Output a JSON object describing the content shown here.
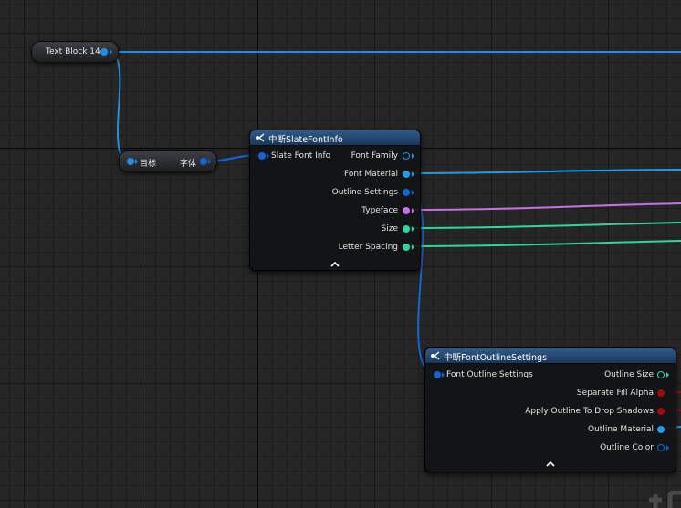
{
  "colors": {
    "object": "#1c8fe8",
    "struct": "#1366d8",
    "material": "#1c9ee6",
    "typeface": "#c773e6",
    "number": "#2ed6a1",
    "bool": "#a10b0b",
    "header": "#2a5384"
  },
  "text_block_node": {
    "label": "Text Block 14"
  },
  "font_getter_node": {
    "target_label": "目标",
    "output_label": "字体"
  },
  "break_slate_font_info": {
    "title": "中断SlateFontInfo",
    "input": "Slate Font Info",
    "outputs": [
      {
        "label": "Font Family",
        "type": "object-hollow"
      },
      {
        "label": "Font Material",
        "type": "material"
      },
      {
        "label": "Outline Settings",
        "type": "struct"
      },
      {
        "label": "Typeface",
        "type": "typeface"
      },
      {
        "label": "Size",
        "type": "number"
      },
      {
        "label": "Letter Spacing",
        "type": "number"
      }
    ],
    "collapse": "^"
  },
  "break_font_outline_settings": {
    "title": "中断FontOutlineSettings",
    "input": "Font Outline Settings",
    "outputs": [
      {
        "label": "Outline Size",
        "type": "number-hollow"
      },
      {
        "label": "Separate Fill Alpha",
        "type": "bool"
      },
      {
        "label": "Apply Outline To Drop Shadows",
        "type": "bool"
      },
      {
        "label": "Outline Material",
        "type": "material"
      },
      {
        "label": "Outline Color",
        "type": "struct-hollow"
      }
    ],
    "collapse": "^"
  },
  "icons": {
    "function": "function-icon",
    "collapse": "chevron-up-icon"
  }
}
